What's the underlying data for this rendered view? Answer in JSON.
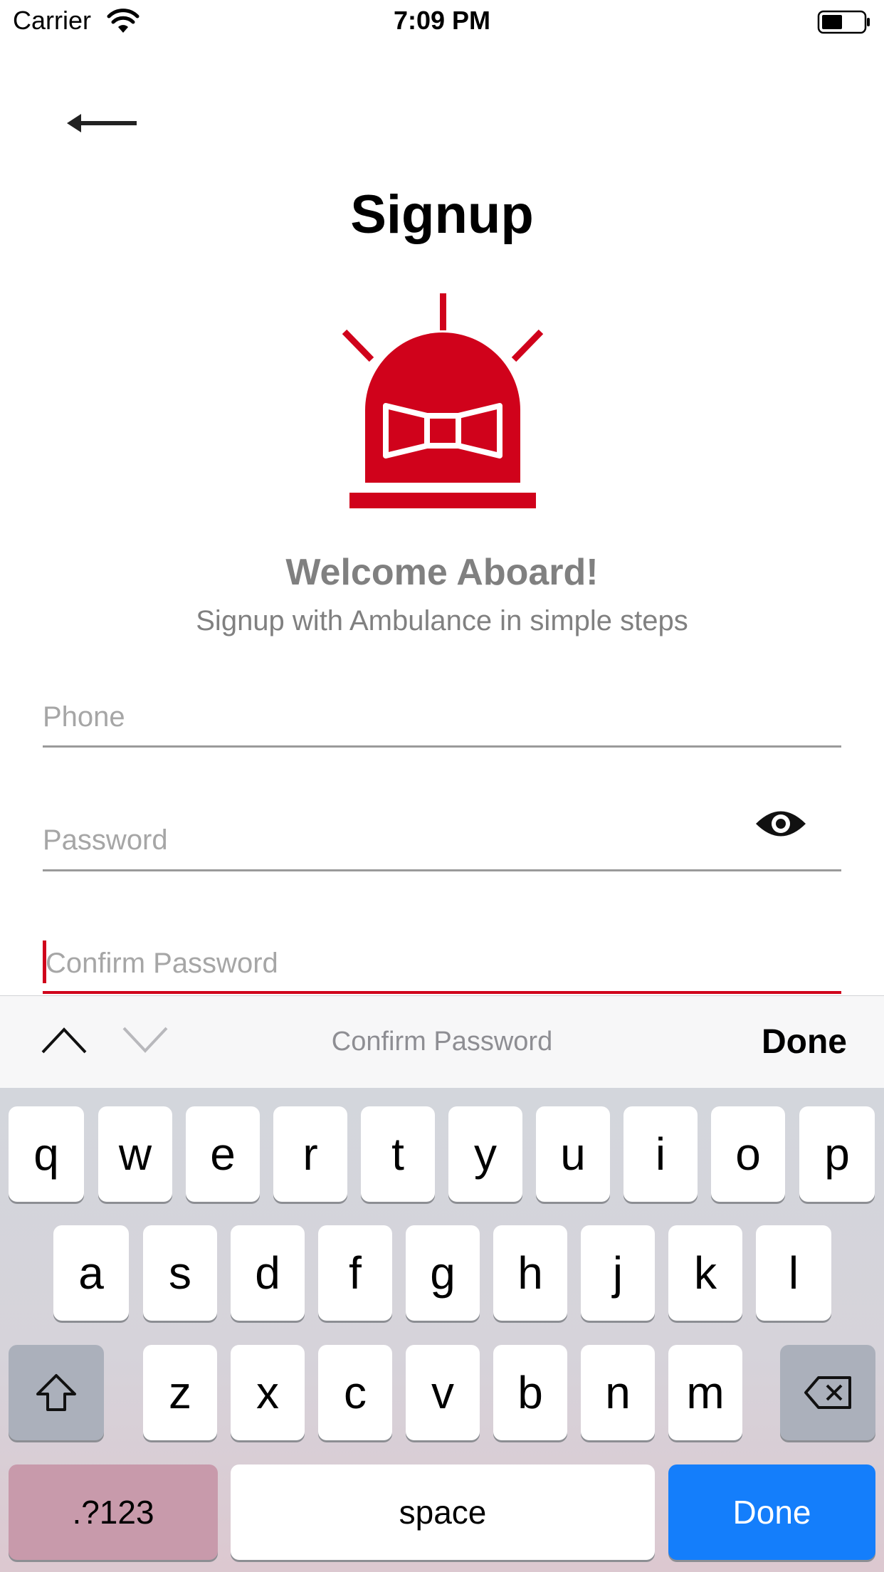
{
  "status_bar": {
    "carrier": "Carrier",
    "time": "7:09 PM"
  },
  "header": {
    "title": "Signup"
  },
  "intro": {
    "welcome": "Welcome Aboard!",
    "subtitle": "Signup with Ambulance in simple steps"
  },
  "form": {
    "phone_placeholder": "Phone",
    "password_placeholder": "Password",
    "confirm_placeholder": "Confirm Password"
  },
  "accessory": {
    "label": "Confirm Password",
    "done": "Done"
  },
  "keyboard": {
    "row1": [
      "q",
      "w",
      "e",
      "r",
      "t",
      "y",
      "u",
      "i",
      "o",
      "p"
    ],
    "row2": [
      "a",
      "s",
      "d",
      "f",
      "g",
      "h",
      "j",
      "k",
      "l"
    ],
    "row3": [
      "z",
      "x",
      "c",
      "v",
      "b",
      "n",
      "m"
    ],
    "numbers": ".?123",
    "space": "space",
    "done": "Done"
  },
  "colors": {
    "accent": "#d0021b",
    "keyboard_done": "#147efb"
  },
  "icons": [
    "wifi-icon",
    "battery-icon",
    "back-arrow-icon",
    "ambulance-siren-logo",
    "eye-icon",
    "chevron-up-icon",
    "chevron-down-icon",
    "shift-icon",
    "backspace-icon"
  ]
}
